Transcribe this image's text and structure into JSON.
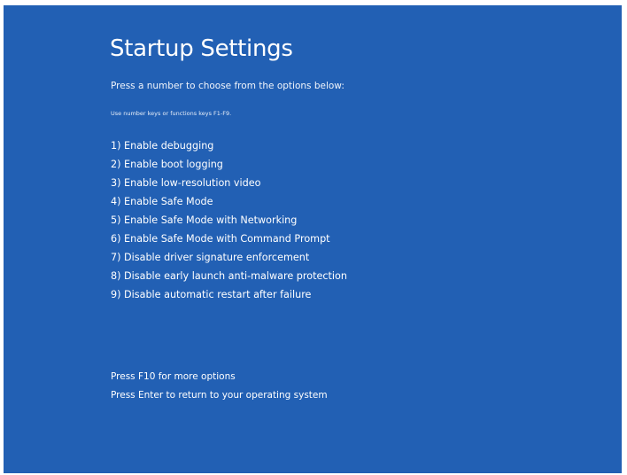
{
  "screen": {
    "title": "Startup Settings",
    "subtitle": "Press a number to choose from the options below:",
    "hint": "Use number keys or functions keys F1-F9.",
    "background_color": "#2260b4",
    "text_color": "#ffffff"
  },
  "options": [
    "1) Enable debugging",
    "2) Enable boot logging",
    "3) Enable low-resolution video",
    "4) Enable Safe Mode",
    "5) Enable Safe Mode with Networking",
    "6) Enable Safe Mode with Command Prompt",
    "7) Disable driver signature enforcement",
    "8) Disable early launch anti-malware protection",
    "9) Disable automatic restart after failure"
  ],
  "footer": {
    "more_options": "Press F10 for more options",
    "return": "Press Enter to return to your operating system"
  }
}
